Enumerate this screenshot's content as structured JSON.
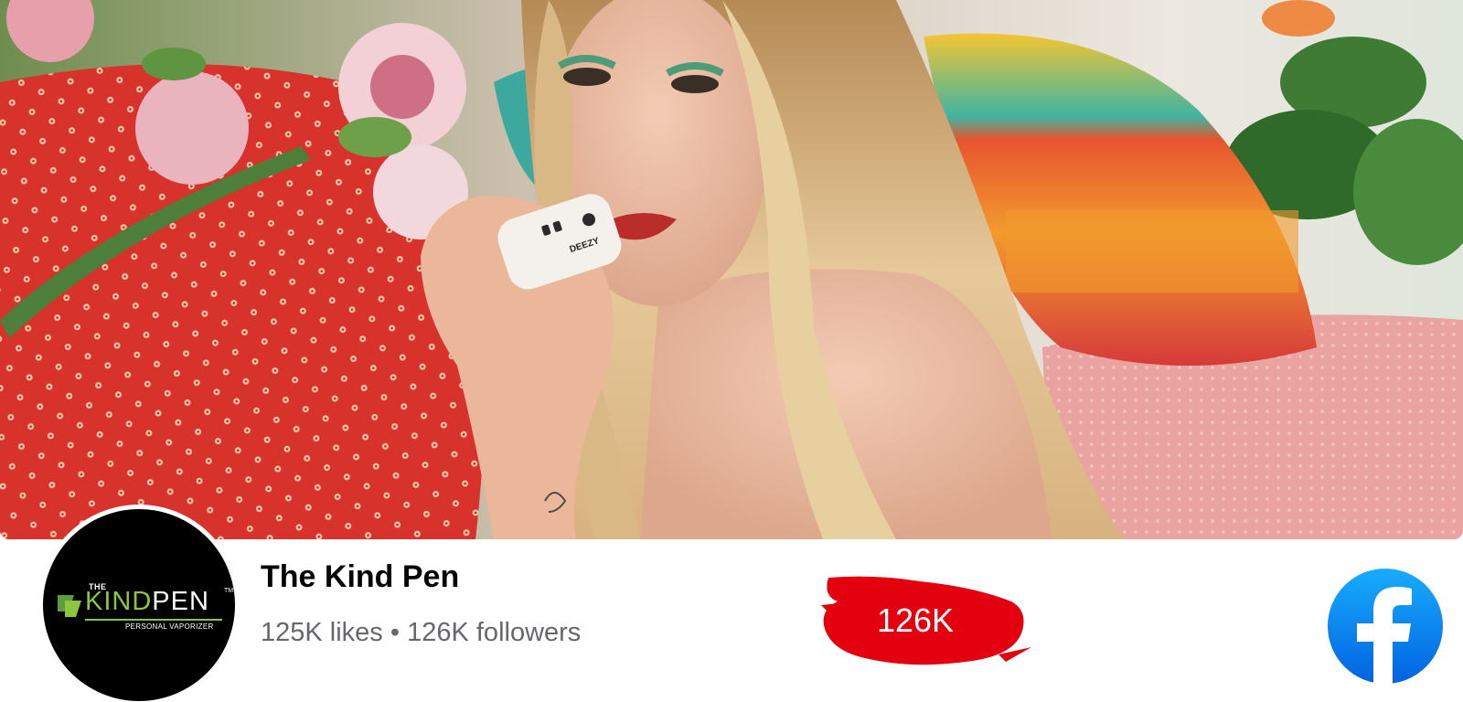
{
  "cover": {
    "product_label": "DEEZY"
  },
  "page": {
    "name": "The Kind Pen",
    "likes": "125K likes",
    "separator": "•",
    "followers": "126K followers"
  },
  "avatar": {
    "logo_the": "THE",
    "logo_kind": "KIND",
    "logo_pen": "PEN",
    "logo_tm": "TM",
    "logo_sub": "PERSONAL VAPORIZER"
  },
  "badge": {
    "count": "126K",
    "color": "#e3000f"
  },
  "brand": {
    "facebook_blue": "#1877f2",
    "kind_green": "#8cc63f",
    "icon": "facebook-icon"
  }
}
